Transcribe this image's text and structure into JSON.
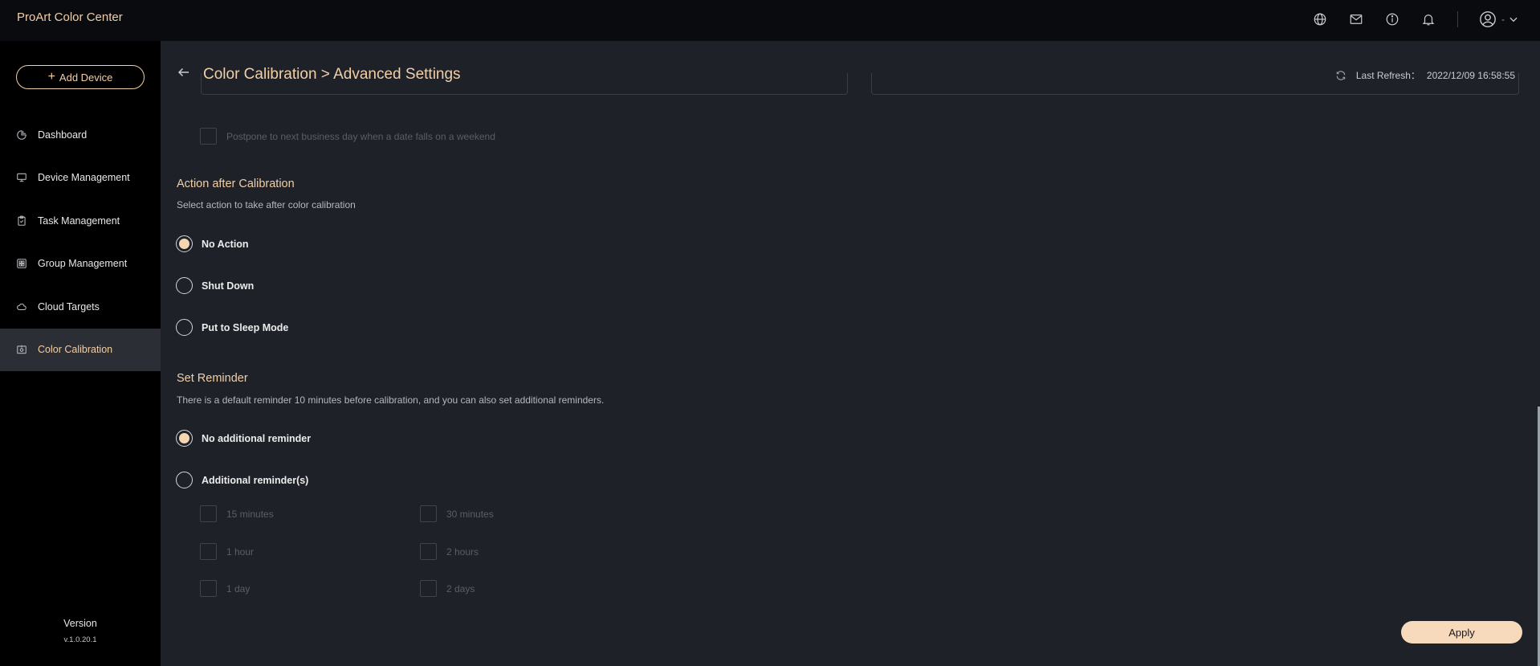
{
  "app": {
    "title": "ProArt Color Center"
  },
  "header": {
    "user_suffix": "-"
  },
  "sidebar": {
    "add_device_label": "Add Device",
    "items": [
      {
        "label": "Dashboard",
        "icon": "pie-chart-icon"
      },
      {
        "label": "Device Management",
        "icon": "monitor-icon"
      },
      {
        "label": "Task Management",
        "icon": "clipboard-icon"
      },
      {
        "label": "Group Management",
        "icon": "grid-icon"
      },
      {
        "label": "Cloud Targets",
        "icon": "cloud-icon"
      },
      {
        "label": "Color Calibration",
        "icon": "calibration-icon",
        "active": true
      }
    ],
    "version_label": "Version",
    "version_number": "v.1.0.20.1"
  },
  "page": {
    "title": "Color Calibration > Advanced Settings",
    "last_refresh_label": "Last Refresh：",
    "last_refresh_value": "2022/12/09 16:58:55"
  },
  "postpone": {
    "label": "Postpone to next business day when a date falls on a weekend",
    "checked": false,
    "disabled": true
  },
  "action_section": {
    "title": "Action after Calibration",
    "description": "Select action to take after color calibration",
    "options": [
      {
        "label": "No Action",
        "checked": true
      },
      {
        "label": "Shut Down",
        "checked": false
      },
      {
        "label": "Put to Sleep Mode",
        "checked": false
      }
    ]
  },
  "reminder_section": {
    "title": "Set Reminder",
    "description": "There is a default reminder 10 minutes before calibration, and you can also set additional reminders.",
    "options": [
      {
        "label": "No additional reminder",
        "checked": true
      },
      {
        "label": "Additional reminder(s)",
        "checked": false
      }
    ],
    "times": [
      {
        "label": "15 minutes",
        "checked": false,
        "disabled": true
      },
      {
        "label": "30 minutes",
        "checked": false,
        "disabled": true
      },
      {
        "label": "1 hour",
        "checked": false,
        "disabled": true
      },
      {
        "label": "2 hours",
        "checked": false,
        "disabled": true
      },
      {
        "label": "1 day",
        "checked": false,
        "disabled": true
      },
      {
        "label": "2 days",
        "checked": false,
        "disabled": true
      }
    ]
  },
  "footer": {
    "apply_label": "Apply"
  },
  "colors": {
    "accent": "#f1cfa8",
    "background": "#1e2128",
    "sidebar": "#000000",
    "active_nav": "#2b2e35"
  }
}
